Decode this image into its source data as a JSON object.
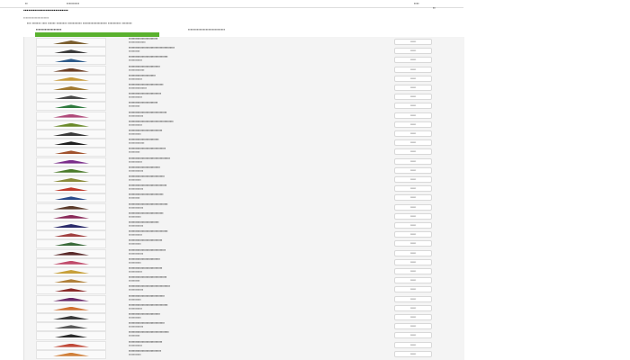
{
  "topbar": {
    "logo_text": "▪▪",
    "nav_text": "▪▪▪▪▪▪▪▪▪▪",
    "right_text": "▪▪▪▪",
    "right_text2": "▪▪"
  },
  "page": {
    "title": "▪▪▪▪▪▪▪▪▪▪▪▪▪▪▪▪▪▪▪▪▪▪▪▪▪▪▪▪",
    "breadcrumb": "▪▪▪▪▪▪▪▪▪▪▪▪▪▪▪▪▪▪▪▪",
    "description": "▪▪▪ ▪▪▪▪▪▪▪ ▪▪▪▪ ▪▪▪▪▪▪ ▪▪▪▪▪▪▪▪ ▪▪▪▪▪▪▪▪▪▪▪ ▪▪▪▪▪▪▪▪▪▪▪▪▪▪▪▪▪▪▪ ▪▪▪▪▪▪▪▪▪▪ ▪▪▪▪▪▪▪▪",
    "section_title": "▪▪▪▪▪▪▪▪▪▪▪▪▪▪▪▪▪▪▪▪",
    "section_info": "▪▪▪▪▪▪▪▪▪▪▪▪▪▪▪▪▪▪▪▪▪▪▪▪▪▪▪▪▪"
  },
  "colors": {
    "accent": "#5ab12e",
    "panel_bg": "#f4f4f4"
  },
  "rows": [
    {
      "title": "▪▪▪▪▪▪▪▪▪▪▪▪▪▪▪▪▪▪▪▪▪▪▪▪▪▪",
      "meta": "▪▪▪▪▪▪▪▪▪▪▪▪▪▪▪",
      "button": "▪▪▪▪▪▪",
      "thumb_color": "#7a5d2e"
    },
    {
      "title": "▪▪▪▪▪▪▪▪▪▪▪▪▪▪▪▪▪▪▪▪▪▪▪▪▪▪▪▪▪▪▪▪▪▪▪▪▪▪▪▪▪",
      "meta": "▪▪▪▪▪▪▪▪▪▪",
      "button": "▪▪▪▪▪▪",
      "thumb_color": "#3a3a3a"
    },
    {
      "title": "▪▪▪▪▪▪▪▪▪▪▪▪▪▪▪▪▪▪▪▪▪▪▪▪▪▪▪▪▪▪▪▪▪▪▪",
      "meta": "▪▪▪▪▪▪▪▪▪▪▪▪",
      "button": "▪▪▪▪▪▪",
      "thumb_color": "#2d5a8a"
    },
    {
      "title": "▪▪▪▪▪▪▪▪▪▪▪▪▪▪▪▪▪▪▪▪▪▪▪▪▪▪▪▪",
      "meta": "▪▪▪▪▪▪▪▪▪▪▪▪▪▪",
      "button": "▪▪▪▪▪▪",
      "thumb_color": "#6a3d24"
    },
    {
      "title": "▪▪▪▪▪▪▪▪▪▪▪▪▪▪▪▪▪▪▪▪▪▪▪▪",
      "meta": "▪▪▪▪▪▪▪▪▪▪▪▪",
      "button": "▪▪▪▪▪▪",
      "thumb_color": "#c79a3a"
    },
    {
      "title": "▪▪▪▪▪▪▪▪▪▪▪▪▪▪▪▪▪▪▪▪▪▪▪▪▪▪▪▪▪▪▪",
      "meta": "▪▪▪▪▪▪▪▪▪▪▪▪▪▪▪▪",
      "button": "▪▪▪▪▪▪",
      "thumb_color": "#a07830"
    },
    {
      "title": "▪▪▪▪▪▪▪▪▪▪▪▪▪▪▪▪▪▪▪▪▪▪▪▪▪▪▪▪▪",
      "meta": "▪▪▪▪▪▪▪▪▪▪▪▪",
      "button": "▪▪▪▪▪▪",
      "thumb_color": "#4a4a4a"
    },
    {
      "title": "▪▪▪▪▪▪▪▪▪▪▪▪▪▪▪▪▪▪▪▪▪▪▪▪▪▪",
      "meta": "▪▪▪▪▪▪▪▪▪▪",
      "button": "▪▪▪▪▪▪",
      "thumb_color": "#2f7a3e"
    },
    {
      "title": "▪▪▪▪▪▪▪▪▪▪▪▪▪▪▪▪▪▪▪▪▪▪▪▪▪▪▪▪▪▪▪▪▪▪",
      "meta": "▪▪▪▪▪▪▪▪▪▪▪▪▪",
      "button": "▪▪▪▪▪▪",
      "thumb_color": "#b04a7a"
    },
    {
      "title": "▪▪▪▪▪▪▪▪▪▪▪▪▪▪▪▪▪▪▪▪▪▪▪▪▪▪▪▪▪▪▪▪▪▪▪▪▪▪▪▪",
      "meta": "▪▪▪▪▪▪▪▪▪▪▪▪",
      "button": "▪▪▪▪▪▪",
      "thumb_color": "#6a8a2a"
    },
    {
      "title": "▪▪▪▪▪▪▪▪▪▪▪▪▪▪▪▪▪▪▪▪▪▪▪▪▪▪▪▪▪▪",
      "meta": "▪▪▪▪▪▪▪▪▪▪▪",
      "button": "▪▪▪▪▪▪",
      "thumb_color": "#3a3a3a"
    },
    {
      "title": "▪▪▪▪▪▪▪▪▪▪▪▪▪▪▪▪▪▪▪▪▪▪▪▪▪▪▪",
      "meta": "▪▪▪▪▪▪▪▪▪▪▪▪▪▪",
      "button": "▪▪▪▪▪▪",
      "thumb_color": "#1f1f1f"
    },
    {
      "title": "▪▪▪▪▪▪▪▪▪▪▪▪▪▪▪▪▪▪▪▪▪▪▪▪▪▪▪▪▪▪▪▪▪",
      "meta": "▪▪▪▪▪▪▪▪▪▪",
      "button": "▪▪▪▪▪▪",
      "thumb_color": "#a0522d"
    },
    {
      "title": "▪▪▪▪▪▪▪▪▪▪▪▪▪▪▪▪▪▪▪▪▪▪▪▪▪▪▪▪▪▪▪▪▪▪▪▪▪",
      "meta": "▪▪▪▪▪▪▪▪▪▪▪▪",
      "button": "▪▪▪▪▪▪",
      "thumb_color": "#7a2d8a"
    },
    {
      "title": "▪▪▪▪▪▪▪▪▪▪▪▪▪▪▪▪▪▪▪▪▪▪▪▪▪▪▪▪",
      "meta": "▪▪▪▪▪▪▪▪▪▪▪▪▪",
      "button": "▪▪▪▪▪▪",
      "thumb_color": "#4a7a2a"
    },
    {
      "title": "▪▪▪▪▪▪▪▪▪▪▪▪▪▪▪▪▪▪▪▪▪▪▪▪▪▪▪▪▪▪▪▪",
      "meta": "▪▪▪▪▪▪▪▪▪▪▪",
      "button": "▪▪▪▪▪▪",
      "thumb_color": "#8a8a3a"
    },
    {
      "title": "▪▪▪▪▪▪▪▪▪▪▪▪▪▪▪▪▪▪▪▪▪▪▪▪▪▪▪▪▪▪▪▪▪▪",
      "meta": "▪▪▪▪▪▪▪▪▪▪▪▪▪",
      "button": "▪▪▪▪▪▪",
      "thumb_color": "#c0392b"
    },
    {
      "title": "▪▪▪▪▪▪▪▪▪▪▪▪▪▪▪▪▪▪▪▪▪▪▪▪▪▪▪▪▪▪▪",
      "meta": "▪▪▪▪▪▪▪▪▪▪",
      "button": "▪▪▪▪▪▪",
      "thumb_color": "#2a4a8a"
    },
    {
      "title": "▪▪▪▪▪▪▪▪▪▪▪▪▪▪▪▪▪▪▪▪▪▪▪▪▪▪▪▪▪▪▪▪▪▪▪",
      "meta": "▪▪▪▪▪▪▪▪▪▪▪▪▪",
      "button": "▪▪▪▪▪▪",
      "thumb_color": "#5a3a2a"
    },
    {
      "title": "▪▪▪▪▪▪▪▪▪▪▪▪▪▪▪▪▪▪▪▪▪▪▪▪▪▪▪▪▪▪▪",
      "meta": "▪▪▪▪▪▪▪▪▪▪▪",
      "button": "▪▪▪▪▪▪",
      "thumb_color": "#8a2a5a"
    },
    {
      "title": "▪▪▪▪▪▪▪▪▪▪▪▪▪▪▪▪▪▪▪▪▪▪▪▪▪▪▪",
      "meta": "▪▪▪▪▪▪▪▪▪▪▪▪▪",
      "button": "▪▪▪▪▪▪",
      "thumb_color": "#2a2a6a"
    },
    {
      "title": "▪▪▪▪▪▪▪▪▪▪▪▪▪▪▪▪▪▪▪▪▪▪▪▪▪▪▪▪▪▪▪▪▪▪▪",
      "meta": "▪▪▪▪▪▪▪▪▪▪▪▪",
      "button": "▪▪▪▪▪▪",
      "thumb_color": "#a04040"
    },
    {
      "title": "▪▪▪▪▪▪▪▪▪▪▪▪▪▪▪▪▪▪▪▪▪▪▪▪▪▪▪▪▪▪",
      "meta": "▪▪▪▪▪▪▪▪▪▪▪",
      "button": "▪▪▪▪▪▪",
      "thumb_color": "#3a6a3a"
    },
    {
      "title": "▪▪▪▪▪▪▪▪▪▪▪▪▪▪▪▪▪▪▪▪▪▪▪▪▪▪▪▪▪▪▪▪▪",
      "meta": "▪▪▪▪▪▪▪▪▪▪▪▪▪",
      "button": "▪▪▪▪▪▪",
      "thumb_color": "#5a2a2a"
    },
    {
      "title": "▪▪▪▪▪▪▪▪▪▪▪▪▪▪▪▪▪▪▪▪▪▪▪▪▪▪▪▪",
      "meta": "▪▪▪▪▪▪▪▪▪▪▪",
      "button": "▪▪▪▪▪▪",
      "thumb_color": "#c04a6a"
    },
    {
      "title": "▪▪▪▪▪▪▪▪▪▪▪▪▪▪▪▪▪▪▪▪▪▪▪▪▪▪▪▪▪▪",
      "meta": "▪▪▪▪▪▪▪▪▪▪▪▪",
      "button": "▪▪▪▪▪▪",
      "thumb_color": "#c7a03a"
    },
    {
      "title": "▪▪▪▪▪▪▪▪▪▪▪▪▪▪▪▪▪▪▪▪▪▪▪▪▪▪▪▪▪▪▪▪▪▪",
      "meta": "▪▪▪▪▪▪▪▪▪▪",
      "button": "▪▪▪▪▪▪",
      "thumb_color": "#b0803a"
    },
    {
      "title": "▪▪▪▪▪▪▪▪▪▪▪▪▪▪▪▪▪▪▪▪▪▪▪▪▪▪▪▪▪▪▪▪▪▪▪▪▪",
      "meta": "▪▪▪▪▪▪▪▪▪▪▪▪▪",
      "button": "▪▪▪▪▪▪",
      "thumb_color": "#8a2a2a"
    },
    {
      "title": "▪▪▪▪▪▪▪▪▪▪▪▪▪▪▪▪▪▪▪▪▪▪▪▪▪▪▪▪▪▪▪▪",
      "meta": "▪▪▪▪▪▪▪▪▪▪▪",
      "button": "▪▪▪▪▪▪",
      "thumb_color": "#6a2a6a"
    },
    {
      "title": "▪▪▪▪▪▪▪▪▪▪▪▪▪▪▪▪▪▪▪▪▪▪▪▪▪▪▪▪▪▪▪▪▪▪▪",
      "meta": "▪▪▪▪▪▪▪▪▪▪▪▪",
      "button": "▪▪▪▪▪▪",
      "thumb_color": "#d07030"
    },
    {
      "title": "▪▪▪▪▪▪▪▪▪▪▪▪▪▪▪▪▪▪▪▪▪▪▪▪▪▪▪▪",
      "meta": "▪▪▪▪▪▪▪▪▪▪▪",
      "button": "▪▪▪▪▪▪",
      "thumb_color": "#3a3a3a"
    },
    {
      "title": "▪▪▪▪▪▪▪▪▪▪▪▪▪▪▪▪▪▪▪▪▪▪▪▪▪▪▪▪▪▪▪▪",
      "meta": "▪▪▪▪▪▪▪▪▪▪▪▪▪",
      "button": "▪▪▪▪▪▪",
      "thumb_color": "#5a5a5a"
    },
    {
      "title": "▪▪▪▪▪▪▪▪▪▪▪▪▪▪▪▪▪▪▪▪▪▪▪▪▪▪▪▪▪▪▪▪▪▪▪▪",
      "meta": "▪▪▪▪▪▪▪▪▪▪",
      "button": "▪▪▪▪▪▪",
      "thumb_color": "#2a2a2a"
    },
    {
      "title": "▪▪▪▪▪▪▪▪▪▪▪▪▪▪▪▪▪▪▪▪▪▪▪▪▪▪▪▪▪▪",
      "meta": "▪▪▪▪▪▪▪▪▪▪▪▪",
      "button": "▪▪▪▪▪▪",
      "thumb_color": "#c04a3a"
    },
    {
      "title": "▪▪▪▪▪▪▪▪▪▪▪▪▪▪▪▪▪▪▪▪▪▪▪▪▪▪▪▪▪",
      "meta": "▪▪▪▪▪▪▪▪▪▪▪",
      "button": "▪▪▪▪▪▪",
      "thumb_color": "#d0803a"
    }
  ]
}
